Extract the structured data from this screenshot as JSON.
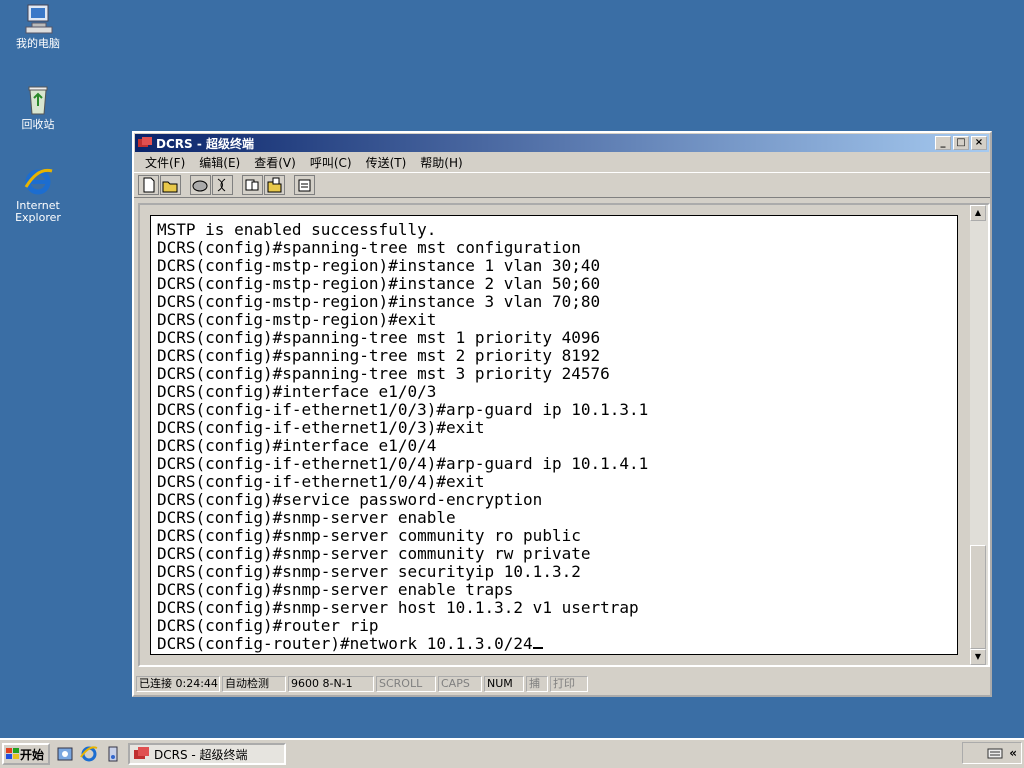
{
  "desktop": {
    "icons": [
      {
        "label": "我的电脑"
      },
      {
        "label": "回收站"
      },
      {
        "label1": "Internet",
        "label2": "Explorer"
      }
    ]
  },
  "window": {
    "title": "DCRS - 超级终端",
    "menu": [
      "文件(F)",
      "编辑(E)",
      "查看(V)",
      "呼叫(C)",
      "传送(T)",
      "帮助(H)"
    ],
    "terminal_lines": [
      "MSTP is enabled successfully.",
      "DCRS(config)#spanning-tree mst configuration",
      "DCRS(config-mstp-region)#instance 1 vlan 30;40",
      "DCRS(config-mstp-region)#instance 2 vlan 50;60",
      "DCRS(config-mstp-region)#instance 3 vlan 70;80",
      "DCRS(config-mstp-region)#exit",
      "DCRS(config)#spanning-tree mst 1 priority 4096",
      "DCRS(config)#spanning-tree mst 2 priority 8192",
      "DCRS(config)#spanning-tree mst 3 priority 24576",
      "DCRS(config)#interface e1/0/3",
      "DCRS(config-if-ethernet1/0/3)#arp-guard ip 10.1.3.1",
      "DCRS(config-if-ethernet1/0/3)#exit",
      "DCRS(config)#interface e1/0/4",
      "DCRS(config-if-ethernet1/0/4)#arp-guard ip 10.1.4.1",
      "DCRS(config-if-ethernet1/0/4)#exit",
      "DCRS(config)#service password-encryption",
      "DCRS(config)#snmp-server enable",
      "DCRS(config)#snmp-server community ro public",
      "DCRS(config)#snmp-server community rw private",
      "DCRS(config)#snmp-server securityip 10.1.3.2",
      "DCRS(config)#snmp-server enable traps",
      "DCRS(config)#snmp-server host 10.1.3.2 v1 usertrap",
      "DCRS(config)#router rip",
      "DCRS(config-router)#network 10.1.3.0/24"
    ],
    "status": {
      "connected": "已连接 0:24:44",
      "detect": "自动检测",
      "port": "9600 8-N-1",
      "scroll": "SCROLL",
      "caps": "CAPS",
      "num": "NUM",
      "capture": "捕",
      "print": "打印"
    }
  },
  "taskbar": {
    "start_label": "开始",
    "task_label": "DCRS - 超级终端"
  },
  "colors": {
    "desktop": "#3a6ea5",
    "title_start": "#0a246a",
    "title_end": "#a6caf0",
    "chrome": "#d4d0c8"
  }
}
